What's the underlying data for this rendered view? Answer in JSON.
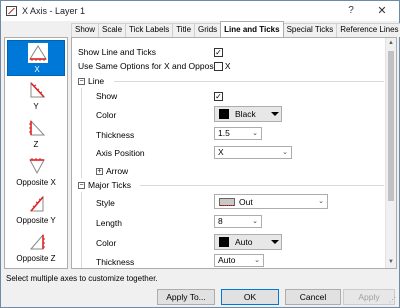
{
  "window": {
    "title": "X Axis - Layer 1",
    "help": "?",
    "close": "✕"
  },
  "tabs": [
    "Show",
    "Scale",
    "Tick Labels",
    "Title",
    "Grids",
    "Line and Ticks",
    "Special Ticks",
    "Reference Lines"
  ],
  "active_tab": "Line and Ticks",
  "axes": [
    {
      "label": "X",
      "selected": true,
      "icon": "axis-x-icon"
    },
    {
      "label": "Y",
      "selected": false,
      "icon": "axis-y-icon"
    },
    {
      "label": "Z",
      "selected": false,
      "icon": "axis-z-icon"
    },
    {
      "label": "Opposite X",
      "selected": false,
      "icon": "axis-opposite-x-icon"
    },
    {
      "label": "Opposite Y",
      "selected": false,
      "icon": "axis-opposite-y-icon"
    },
    {
      "label": "Opposite Z",
      "selected": false,
      "icon": "axis-opposite-z-icon"
    }
  ],
  "options": {
    "show_line_and_ticks": {
      "label": "Show Line and Ticks",
      "checked": true
    },
    "same_options": {
      "label": "Use Same Options for X and Opposite X",
      "checked": false
    }
  },
  "line": {
    "section": "Line",
    "show_label": "Show",
    "show_checked": true,
    "color_label": "Color",
    "color_value": "Black",
    "thickness_label": "Thickness",
    "thickness_value": "1.5",
    "axis_position_label": "Axis Position",
    "axis_position_value": "X",
    "arrow_label": "Arrow"
  },
  "major_ticks": {
    "section": "Major Ticks",
    "style_label": "Style",
    "style_value": "Out",
    "length_label": "Length",
    "length_value": "8",
    "color_label": "Color",
    "color_value": "Auto",
    "thickness_label": "Thickness",
    "thickness_value": "Auto"
  },
  "status": "Select multiple axes to customize together.",
  "buttons": {
    "apply_to": "Apply To...",
    "ok": "OK",
    "cancel": "Cancel",
    "apply": "Apply"
  },
  "colors": {
    "accent": "#0078d7",
    "black": "#000000"
  }
}
